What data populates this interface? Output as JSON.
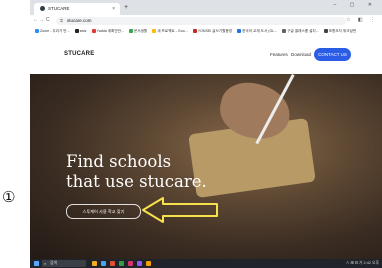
{
  "annotation": {
    "step_marker": "①"
  },
  "browser": {
    "tab": {
      "title": "STUCARE",
      "close": "×"
    },
    "newtab": "+",
    "window_controls": "–  ▢  ✕",
    "nav": {
      "back": "←",
      "forward": "→",
      "reload": "C",
      "home": "⌂"
    },
    "address": {
      "lock": "⚿",
      "url": "stucare.com"
    },
    "toolbar_icons": "☆ ◧ ⋮",
    "bookmarks": [
      {
        "label": "Zoom - 우리가 만...",
        "color": "#2d8cff"
      },
      {
        "label": "swiz",
        "color": "#222222"
      },
      {
        "label": "Yadda 계획안만...",
        "color": "#e53935"
      },
      {
        "label": "문서생활",
        "color": "#34a853"
      },
      {
        "label": "새 프로젝트 - Goo...",
        "color": "#fbbc04"
      },
      {
        "label": "YONSEI 글쓰기활용방",
        "color": "#c62828"
      },
      {
        "label": "한국어 교재 도서 (GL...",
        "color": "#1a73e8"
      },
      {
        "label": "구글 클래스룸 설치...",
        "color": "#5f6368"
      },
      {
        "label": "포항초지 워크샵판",
        "color": "#444444"
      }
    ]
  },
  "site": {
    "logo": "STUCARE",
    "nav": {
      "features": "Features",
      "download": "Download"
    },
    "contact": "CONTACT US",
    "hero": {
      "title_line1": "Find schools",
      "title_line2": "that use stucare.",
      "cta": "스투케어 사용 학교 찾기"
    }
  },
  "taskbar": {
    "search_icon": "⌕",
    "search_placeholder": "검색",
    "icons": [
      "#f2b01e",
      "#4aa3f0",
      "#e04f2f",
      "#2ea043",
      "#d6336c",
      "#8b5cf6",
      "#f59f00"
    ],
    "tray": "∧ ⊞ ⊟ 가 2:42 오후"
  },
  "colors": {
    "accent_blue": "#2b5ce6",
    "arrow_yellow": "#f6e14d",
    "taskbar": "#20242a"
  }
}
